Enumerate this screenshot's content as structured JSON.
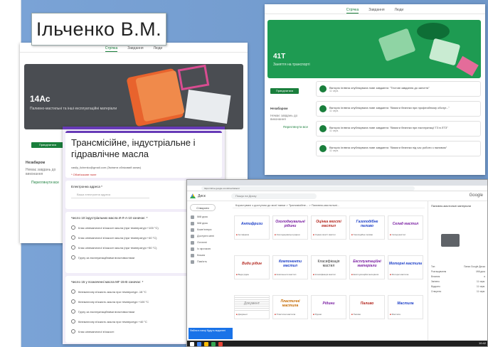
{
  "author": "Ільченко В.М.",
  "classroom_tabs": [
    "Стрічка",
    "Завдання",
    "Люди"
  ],
  "class1": {
    "name": "14Ас",
    "subtitle": "Паливно-мастильні та інші експлуатаційні матеріали",
    "stream_button": "Приєднатися",
    "upcoming": "Незабаром",
    "upcoming_text": "Немає завдань до виконання",
    "view_all": "Переглянути все"
  },
  "class2": {
    "name": "41Т",
    "subtitle": "Заняття на транспорті",
    "stream_button": "Приєднатися",
    "upcoming": "Незабаром",
    "upcoming_text": "Немає завдань до виконання",
    "view_all": "Переглянути все",
    "posts": [
      {
        "text": "Вікторія Іллівна опублікувала нове завдання: \"Тестові завдання до заняття\"",
        "meta": "11 черв."
      },
      {
        "text": "Вікторія Іллівна опублікувала нове завдання: \"Вимоги безпеки при професійному обслуг...\"",
        "meta": "11 черв."
      },
      {
        "text": "Вікторія Іллівна опублікувала нове завдання: \"Вимоги безпеки при експлуатації ТЗ в ЛТЗ\"",
        "meta": "11 черв."
      },
      {
        "text": "Вікторія Іллівна опублікувала нове завдання: \"Вимоги безпеки під час роботи з паливом\"",
        "meta": "11 черв."
      }
    ]
  },
  "form": {
    "title": "Трансмісійне, індустріальне і гідравлічне масла",
    "account": "vasily_ilchenko@gmail.com (Змінити обліковий запис)",
    "required": "* Обов'язкове поле",
    "email_label": "Електронна адреса *",
    "email_placeholder": "Ваша електронна адреса",
    "q1": {
      "text": "Число 10 індустріальних масла И-Л-А-10 означає: *",
      "options": [
        "Клас кінематичної в'язкості масла (при температурі +100 °С)",
        "Клас кінематичної в'язкості масла (при температурі +40 °С)",
        "Клас кінематичної в'язкості масла (при температурі +50 °С)",
        "Групу за експлуатаційними властивостями"
      ]
    },
    "q2": {
      "text": "Число 15 у позначенні масла МГ-15-В означає: *",
      "options": [
        "Кінематичну в'язкість масла при температурі -18 °С",
        "Кінематичну в'язкість масла при температурі +100 °С",
        "Групу за експлуатаційними властивостями",
        "Кінематичну в'язкість масла при температурі +40 °С",
        "Клас кінематичної в'язкості"
      ]
    }
  },
  "drive": {
    "app_name": "Диск",
    "search_placeholder": "Пошук на Диску",
    "brand": "Google",
    "url": "https://drive.google.com/drive/folders/",
    "breadcrumb": "Користувачі з доступом до моєї папки > Трансмісійне... > Паливно-мастильні...",
    "new_button": "Створити",
    "nav": [
      "Мій диск",
      "Мій диск",
      "Комп'ютери",
      "Доступні мені",
      "Останні",
      "Із зірочкою",
      "Кошик",
      "Пам'ять"
    ],
    "side_title": "Паливно-мастильні матеріали",
    "side_rows": [
      {
        "k": "Тип",
        "v": "Папка Google Диска"
      },
      {
        "k": "Розташування",
        "v": "Мій диск"
      },
      {
        "k": "Власник",
        "v": "я"
      },
      {
        "k": "Змінено",
        "v": "11 черв."
      },
      {
        "k": "Відкрито",
        "v": "11 черв."
      },
      {
        "k": "Створено",
        "v": "11 черв."
      }
    ],
    "tiles": [
      "Антифризи",
      "Охолоджувальні рідини",
      "Оцінка якості мастил",
      "Газоподібне паливо",
      "Склад мастил",
      "Види рідин",
      "Компоненти мастил",
      "Класифікація мастил",
      "Експлуатаційні матеріали",
      "Моторні мастила",
      "Документ",
      "Пластичні мастила",
      "Рідини",
      "Паливо",
      "Мастила"
    ],
    "bottom_banner": "Файли в папці будуть видалені",
    "clock": "10:42"
  }
}
